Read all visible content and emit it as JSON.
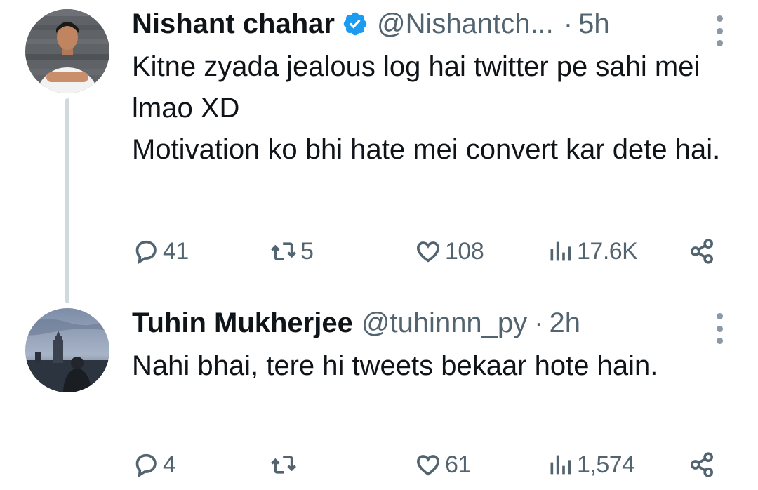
{
  "tweets": [
    {
      "author": "Nishant chahar",
      "verified": true,
      "handle": "@Nishantch...",
      "separator": "·",
      "time": "5h",
      "lines": [
        "Kitne zyada jealous log hai twitter pe sahi mei lmao XD",
        "Motivation ko bhi hate mei convert kar dete hai."
      ],
      "stats": {
        "replies": "41",
        "retweets": "5",
        "likes": "108",
        "views": "17.6K"
      }
    },
    {
      "author": "Tuhin Mukherjee",
      "verified": false,
      "handle": "@tuhinnn_py",
      "separator": "·",
      "time": "2h",
      "lines": [
        "Nahi bhai, tere hi tweets bekaar hote hain."
      ],
      "stats": {
        "replies": "4",
        "retweets": "",
        "likes": "61",
        "views": "1,574"
      }
    }
  ],
  "icons": [
    "reply-icon",
    "retweet-icon",
    "like-icon",
    "views-icon",
    "share-icon",
    "more-icon",
    "verified-badge-icon"
  ],
  "colors": {
    "text": "#0f1419",
    "secondary": "#536471",
    "verified": "#1d9bf0",
    "thread_line": "#cfd9de"
  }
}
